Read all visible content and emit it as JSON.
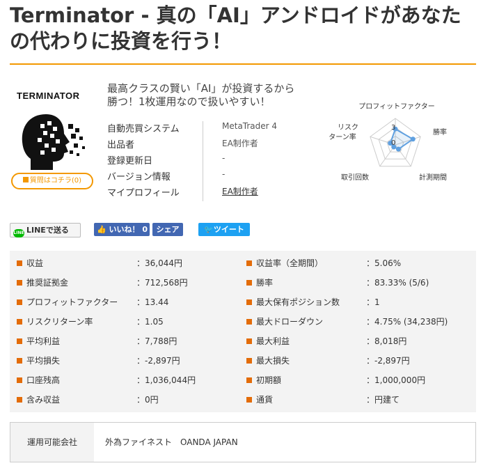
{
  "title_line1": "Terminator - 真の「AI」アンドロイドがあなた",
  "title_line2": "の代わりに投資を行う！",
  "logo_text": "TERMINATOR",
  "question_button": "質問はコチラ(0)",
  "catch_line1": "最高クラスの賢い「AI」が投資するから",
  "catch_line2": "勝つ！1枚運用なので扱いやすい！",
  "info": [
    {
      "label": "自動売買システム",
      "value": "MetaTrader 4"
    },
    {
      "label": "出品者",
      "value": "EA制作者"
    },
    {
      "label": "登録更新日",
      "value": "-"
    },
    {
      "label": "バージョン情報",
      "value": "-"
    },
    {
      "label": "マイプロフィール",
      "value": "EA制作者"
    }
  ],
  "radar": {
    "labels": [
      "プロフィットファクター",
      "勝率",
      "計測期間",
      "取引回数",
      "リスク",
      "ターン率"
    ],
    "scale_labels": [
      "3",
      "0"
    ],
    "values": [
      3,
      3.5,
      1,
      0.5,
      1
    ],
    "max": 5,
    "color": "#5fa0e0"
  },
  "social": {
    "line": "LINEで送る",
    "line_icon": "LINE",
    "like": "いいね！ 0",
    "share": "シェア",
    "tweet": "ツイート"
  },
  "stats_left": [
    {
      "label": "収益",
      "value": "：36,044円"
    },
    {
      "label": "推奨証拠金",
      "value": "：712,568円"
    },
    {
      "label": "プロフィットファクター",
      "value": "：13.44"
    },
    {
      "label": "リスクリターン率",
      "value": "：1.05"
    },
    {
      "label": "平均利益",
      "value": "：7,788円"
    },
    {
      "label": "平均損失",
      "value": "：-2,897円"
    },
    {
      "label": "口座残高",
      "value": "：1,036,044円"
    },
    {
      "label": "含み収益",
      "value": "：0円"
    }
  ],
  "stats_right": [
    {
      "label": "収益率（全期間）",
      "value": "：5.06%"
    },
    {
      "label": "勝率",
      "value": "：83.33% (5/6)"
    },
    {
      "label": "最大保有ポジション数",
      "value": "：1"
    },
    {
      "label": "最大ドローダウン",
      "value": "：4.75% (34,238円)"
    },
    {
      "label": "最大利益",
      "value": "：8,018円"
    },
    {
      "label": "最大損失",
      "value": "：-2,897円"
    },
    {
      "label": "初期額",
      "value": "：1,000,000円"
    },
    {
      "label": "通貨",
      "value": "：円建て"
    }
  ],
  "operator": {
    "label": "運用可能会社",
    "value": "外為ファイネスト　OANDA JAPAN"
  }
}
